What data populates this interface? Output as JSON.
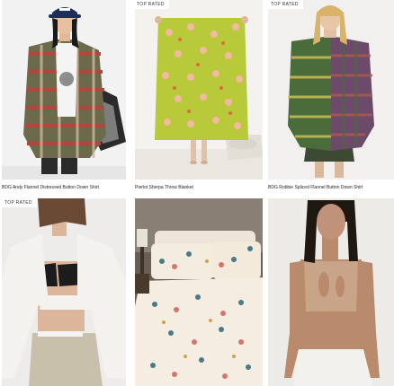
{
  "products": [
    {
      "title": "BDG Andy Flannel Distressed Button Down Shirt",
      "badge": "",
      "image_icon": "model-in-plaid-flannel-shirt-photo"
    },
    {
      "title": "Pierlot Sherpa Throw Blanket",
      "badge": "TOP RATED",
      "image_icon": "model-holding-green-floral-blanket-photo"
    },
    {
      "title": "BDG Robbie Spliced Flannel Button Down Shirt",
      "badge": "TOP RATED",
      "image_icon": "model-in-spliced-flannel-shirt-photo"
    },
    {
      "title": "",
      "badge": "TOP RATED",
      "image_icon": "model-in-white-cardigan-photo"
    },
    {
      "title": "",
      "badge": "",
      "image_icon": "floral-duvet-bedding-photo"
    },
    {
      "title": "",
      "badge": "",
      "image_icon": "model-in-tan-keyhole-top-photo"
    }
  ],
  "colors": {
    "background": "#ffffff",
    "title_text": "#222222",
    "badge_bg": "#ffffff"
  }
}
